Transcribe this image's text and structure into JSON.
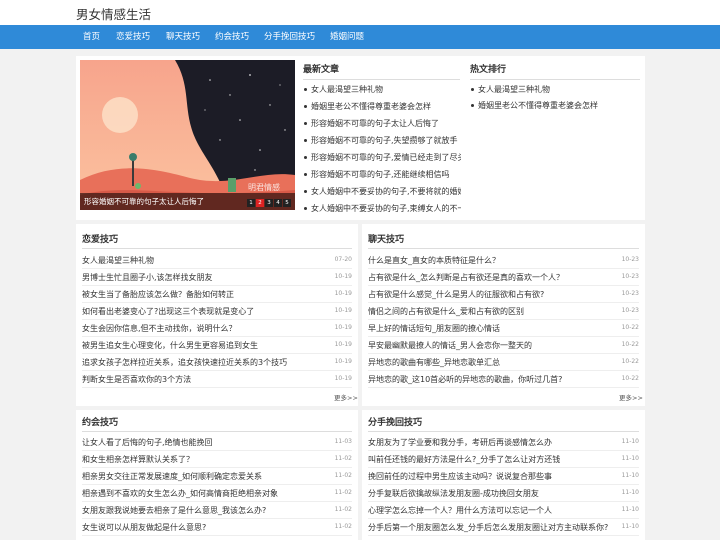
{
  "site": {
    "title": "男女情感生活"
  },
  "nav": [
    "首页",
    "恋爱技巧",
    "聊天技巧",
    "约会技巧",
    "分手挽回技巧",
    "婚姻问题"
  ],
  "slider": {
    "caption": "形容婚姻不可靠的句子太让人后悔了",
    "watermark": "明君情感",
    "dots": [
      "1",
      "2",
      "3",
      "4",
      "5"
    ],
    "active_dot": 2
  },
  "latest": {
    "title": "最新文章",
    "items": [
      "女人最渴望三种礼物",
      "婚姻里老公不懂得尊重老婆会怎样",
      "形容婚姻不可靠的句子太让人后悔了",
      "形容婚姻不可靠的句子,失望攒够了就放手",
      "形容婚姻不可靠的句子,爱情已经走到了尽头",
      "形容婚姻不可靠的句子,还能继续相信吗",
      "女人婚姻中不要妥协的句子,不要将就的婚姻",
      "女人婚姻中不要妥协的句子,束缚女人的不一定"
    ]
  },
  "hot": {
    "title": "热文排行",
    "items": [
      "女人最渴望三种礼物",
      "婚姻里老公不懂得尊重老婆会怎样"
    ]
  },
  "love": {
    "title": "恋爱技巧",
    "more": "更多>>",
    "items": [
      {
        "t": "女人最渴望三种礼物",
        "d": "07-20"
      },
      {
        "t": "男博士生忙且圈子小,该怎样找女朋友",
        "d": "10-19"
      },
      {
        "t": "被女生当了备胎应该怎么做？备胎如何转正",
        "d": "10-19"
      },
      {
        "t": "如何看出老婆变心了?出现这三个表现就是变心了",
        "d": "10-19"
      },
      {
        "t": "女生会因你信息,但不主动找你，说明什么？",
        "d": "10-19"
      },
      {
        "t": "被男生追女生心理变化，什么男生更容易追到女生",
        "d": "10-19"
      },
      {
        "t": "追求女孩子怎样拉近关系，追女孩快速拉近关系的3个技巧",
        "d": "10-19"
      },
      {
        "t": "判断女生是否喜欢你的3个方法",
        "d": "10-19"
      }
    ]
  },
  "chat": {
    "title": "聊天技巧",
    "more": "更多>>",
    "items": [
      {
        "t": "什么是直女_直女的本质特征是什么？",
        "d": "10-23"
      },
      {
        "t": "占有欲是什么_怎么判断是占有欲还是真的喜欢一个人？",
        "d": "10-23"
      },
      {
        "t": "占有欲是什么感觉_什么是男人的征服欲和占有欲?",
        "d": "10-23"
      },
      {
        "t": "情侣之间的占有欲是什么_爱和占有欲的区别",
        "d": "10-23"
      },
      {
        "t": "早上好的情话短句_朋友圈的撩心情话",
        "d": "10-22"
      },
      {
        "t": "早安最幽默最撩人的情话_男人会恋你一整天的",
        "d": "10-22"
      },
      {
        "t": "异地恋的歌曲有哪些_异地恋歌单汇总",
        "d": "10-22"
      },
      {
        "t": "异地恋的歌_这10首必听的异地恋的歌曲，你听过几首?",
        "d": "10-22"
      }
    ]
  },
  "date": {
    "title": "约会技巧",
    "items": [
      {
        "t": "让女人看了后悔的句子,绝情也能挽回",
        "d": "11-03"
      },
      {
        "t": "和女生相亲怎样算默认关系了？",
        "d": "11-02"
      },
      {
        "t": "相亲男女交往正常发展速度_如何顺利确定恋爱关系",
        "d": "11-02"
      },
      {
        "t": "相亲遇到不喜欢的女生怎么办_如何高情商拒绝相亲对象",
        "d": "11-02"
      },
      {
        "t": "女朋友跟我说她要去相亲了是什么意思_我该怎么办?",
        "d": "11-02"
      },
      {
        "t": "女生说可以从朋友做起是什么意思?",
        "d": "11-02"
      }
    ]
  },
  "breakup": {
    "title": "分手挽回技巧",
    "items": [
      {
        "t": "女朋友为了学业要和我分手，考研后再谈感情怎么办",
        "d": "11-10"
      },
      {
        "t": "叫前任还钱的最好方法是什么?_分手了怎么让对方还钱",
        "d": "11-10"
      },
      {
        "t": "挽回前任的过程中男生应该主动吗？说说复合那些事",
        "d": "11-10"
      },
      {
        "t": "分手复联后欲擒故纵法发朋友圈-成功挽回女朋友",
        "d": "11-10"
      },
      {
        "t": "心理学怎么忘掉一个人？用什么方法可以忘记一个人",
        "d": "11-10"
      },
      {
        "t": "分手后第一个朋友圈怎么发_分手后怎么发朋友圈让对方主动联系你?",
        "d": "11-10"
      }
    ]
  }
}
